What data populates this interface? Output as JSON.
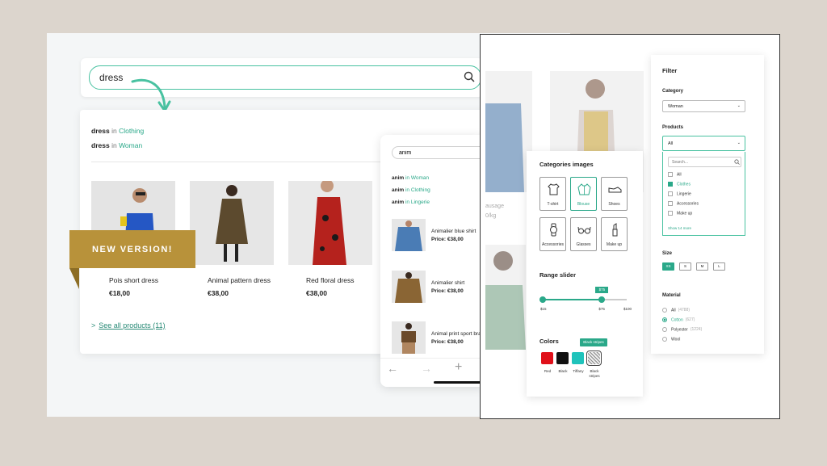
{
  "search": {
    "value": "dress"
  },
  "suggestions": [
    {
      "term": "dress",
      "in": "in",
      "category": "Clothing"
    },
    {
      "term": "dress",
      "in": "in",
      "category": "Woman"
    }
  ],
  "products": [
    {
      "name": "Pois short dress",
      "price": "€18,00"
    },
    {
      "name": "Animal pattern dress",
      "price": "€38,00"
    },
    {
      "name": "Red floral dress",
      "price": "€38,00"
    }
  ],
  "see_all": {
    "arrow": ">",
    "label": "See all products (11)"
  },
  "ribbon": "NEW VERSION!",
  "mobile": {
    "search_value": "anim",
    "suggestions": [
      {
        "term": "anim",
        "in": "in",
        "category": "Woman"
      },
      {
        "term": "anim",
        "in": "in",
        "category": "Clothing"
      },
      {
        "term": "anim",
        "in": "in",
        "category": "Lingerie"
      }
    ],
    "products": [
      {
        "name": "Animalier blue shirt",
        "price": "Price: €38,00"
      },
      {
        "name": "Animalier shirt",
        "price": "Price: €38,00"
      },
      {
        "name": "Animal print sport bra",
        "price": "Price: €38,00"
      }
    ],
    "nav": {
      "back": "←",
      "forward": "→",
      "add": "+"
    }
  },
  "background_text": {
    "line1": "ausage",
    "line2": "0/kg"
  },
  "categories_card": {
    "title": "Categories images",
    "tiles": [
      "T-shirt",
      "Blouse",
      "Shoes",
      "Accessories",
      "Glasses",
      "Make up"
    ],
    "selected_tile": "Blouse",
    "range_title": "Range slider",
    "range": {
      "min_label": "$15",
      "max_label": "$100",
      "low_label": "$15",
      "high_label": "$75",
      "tooltip": "$75",
      "min": 15,
      "max": 100,
      "low": 15,
      "high": 75
    },
    "colors_title": "Colors",
    "colors": [
      {
        "name": "Red",
        "hex": "#e0101a"
      },
      {
        "name": "Black",
        "hex": "#111111"
      },
      {
        "name": "Tiffany",
        "hex": "#1fc3bb"
      },
      {
        "name": "Black stripes",
        "hex": "#bbbbbb"
      }
    ],
    "color_tooltip": "Black stripes"
  },
  "filter": {
    "title": "Filter",
    "category_label": "Category",
    "category_value": "Woman",
    "products_label": "Products",
    "products_value": "All",
    "dropdown_search_placeholder": "Search...",
    "options": [
      {
        "label": "All",
        "checked": false
      },
      {
        "label": "Clothes",
        "checked": true
      },
      {
        "label": "Lingerie",
        "checked": false
      },
      {
        "label": "Accessories",
        "checked": false
      },
      {
        "label": "Make up",
        "checked": false
      }
    ],
    "show_more": "Show 14 more",
    "size_label": "Size",
    "sizes": [
      "XS",
      "S",
      "M",
      "L"
    ],
    "selected_size": "XS",
    "material_label": "Material",
    "materials": [
      {
        "label": "All",
        "count": "(4788)",
        "selected": false
      },
      {
        "label": "Cotton",
        "count": "(627)",
        "selected": true
      },
      {
        "label": "Polyester",
        "count": "(1224)",
        "selected": false
      },
      {
        "label": "Wool",
        "count": "",
        "selected": false
      }
    ]
  },
  "colors": {
    "accent": "#2aa889",
    "ribbon": "#b8923a",
    "background": "#dcd5cd"
  }
}
